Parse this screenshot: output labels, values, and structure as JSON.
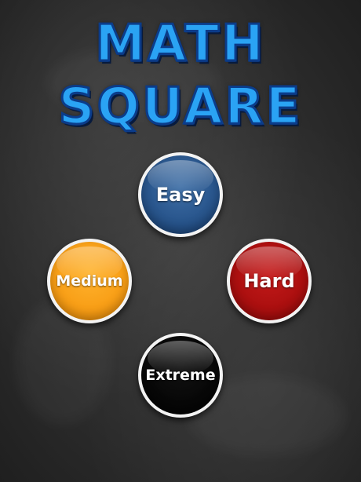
{
  "title": {
    "line1": "MATH",
    "line2": "SQUARE",
    "color": "#2aa3f4"
  },
  "difficulty_buttons": {
    "easy": {
      "label": "Easy",
      "color": "#234f86"
    },
    "medium": {
      "label": "Medium",
      "color": "#f79a11"
    },
    "hard": {
      "label": "Hard",
      "color": "#a60d0d"
    },
    "extreme": {
      "label": "Extreme",
      "color": "#000000"
    }
  },
  "background": "chalkboard"
}
